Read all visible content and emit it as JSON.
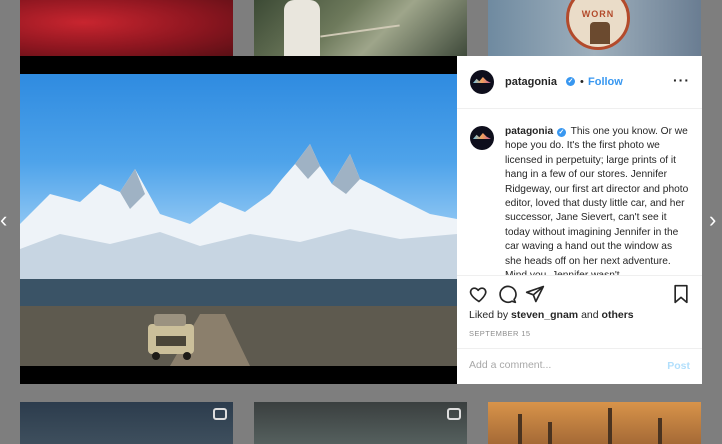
{
  "nav": {
    "prev_glyph": "‹",
    "next_glyph": "›"
  },
  "grid": {
    "top_row": [
      "red-photo",
      "child-fishing-photo",
      "worn-wear-badge-photo"
    ],
    "worn_badge_text": "WORN",
    "bottom_row": [
      "video-thumbnail",
      "video-thumbnail",
      "industrial-photo"
    ]
  },
  "post": {
    "header": {
      "username": "patagonia",
      "separator": "•",
      "follow_label": "Follow",
      "more_glyph": "···"
    },
    "caption": {
      "username": "patagonia",
      "text": "This one you know. Or we hope you do. It's the first photo we licensed in perpetuity; large prints of it hang in a few of our stores. Jennifer Ridgeway, our first art director and photo editor, loved that dusty little car, and her successor, Jane Sievert, can't see it today without imagining Jennifer in the car waving a hand out the window as she heads off on her next adventure. Mind you, Jennifer wasn't"
    },
    "actions": {
      "icons": [
        "heart-icon",
        "comment-icon",
        "share-icon",
        "bookmark-icon"
      ],
      "likes_prefix": "Liked by",
      "likes_user": "steven_gnam",
      "likes_and": "and",
      "likes_others": "others",
      "date": "SEPTEMBER 15"
    },
    "comment": {
      "placeholder": "Add a comment...",
      "post_label": "Post"
    }
  },
  "colors": {
    "accent": "#3897f0",
    "post_disabled": "#b2dffc",
    "overlay": "#7e7e7e"
  }
}
